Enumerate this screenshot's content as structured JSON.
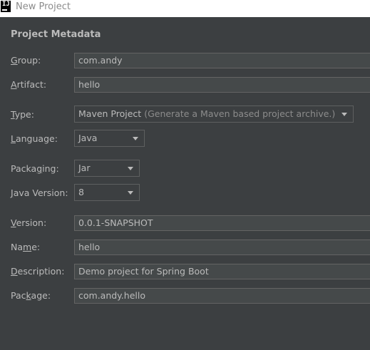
{
  "window": {
    "title": "New Project",
    "icon": "intellij-icon"
  },
  "section": {
    "title": "Project Metadata"
  },
  "fields": {
    "group": {
      "label_pre": "",
      "label_mn": "G",
      "label_post": "roup:",
      "value": "com.andy"
    },
    "artifact": {
      "label_pre": "",
      "label_mn": "A",
      "label_post": "rtifact:",
      "value": "hello"
    },
    "type": {
      "label_pre": "",
      "label_mn": "T",
      "label_post": "ype:",
      "value": "Maven Project",
      "hint": "(Generate a Maven based project archive.)"
    },
    "language": {
      "label_pre": "",
      "label_mn": "L",
      "label_post": "anguage:",
      "value": "Java"
    },
    "packaging": {
      "label_pre": "Packa",
      "label_mn": "g",
      "label_post": "ing:",
      "value": "Jar"
    },
    "java_version": {
      "label_pre": "",
      "label_mn": "J",
      "label_post": "ava Version:",
      "value": "8"
    },
    "version": {
      "label_pre": "",
      "label_mn": "V",
      "label_post": "ersion:",
      "value": "0.0.1-SNAPSHOT"
    },
    "name": {
      "label_pre": "Na",
      "label_mn": "m",
      "label_post": "e:",
      "value": "hello"
    },
    "description": {
      "label_pre": "",
      "label_mn": "D",
      "label_post": "escription:",
      "value": "Demo project for Spring Boot"
    },
    "package": {
      "label_pre": "Pac",
      "label_mn": "k",
      "label_post": "age:",
      "value": "com.andy.hello"
    }
  }
}
